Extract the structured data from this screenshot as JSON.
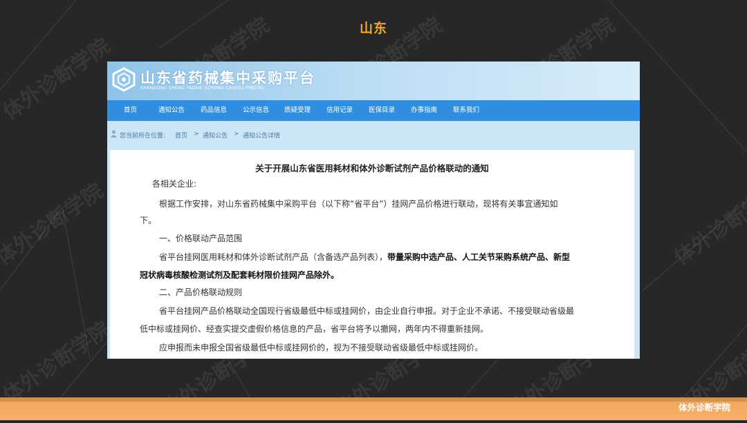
{
  "slide": {
    "title": "山东",
    "watermark": "体外诊断学院",
    "footer_text": "体外诊断学院",
    "accent_color": "#f5a623",
    "footer_color": "#f4a862"
  },
  "site": {
    "name": "山东省药械集中采购平台",
    "pinyin": "SHANDONG SHENG YAOXIE JIZHONG CAIGOU PINGTAI",
    "nav": [
      "首页",
      "通知公告",
      "药品信息",
      "公示信息",
      "质疑受理",
      "信用记录",
      "医保目录",
      "办事指南",
      "联系我们"
    ],
    "breadcrumb": {
      "prefix": "您当前所在位置:",
      "items": [
        "首页",
        "通知公告",
        "通知公告详情"
      ],
      "separator": ">"
    }
  },
  "notice": {
    "title": "关于开展山东省医用耗材和体外诊断试剂产品价格联动的通知",
    "salutation": "各相关企业:",
    "p1_l1": "根据工作安排，对山东省药械集中采购平台（以下称“省平台”）挂网产品价格进行联动，现将有关事宜通知如",
    "p1_l2": "下。",
    "h1": "一、价格联动产品范围",
    "p2_l1_normal": "省平台挂网医用耗材和体外诊断试剂产品（含备选产品列表），",
    "p2_l1_bold": "带量采购中选产品、人工关节采购系统产品、新型",
    "p2_l2_bold": "冠状病毒核酸检测试剂及配套耗材限价挂网产品除外。",
    "h2": "二、产品价格联动规则",
    "p3_l1": "省平台挂网产品价格联动全国现行省级最低中标或挂网价，由企业自行申报。对于企业不承诺、不接受联动省级最",
    "p3_l2": "低中标或挂网价、经查实提交虚假价格信息的产品，省平台将予以撤网，两年内不得重新挂网。",
    "p4_l1": "应申报而未申报全国省级最低中标或挂网价的，视为不接受联动省级最低中标或挂网价。"
  }
}
